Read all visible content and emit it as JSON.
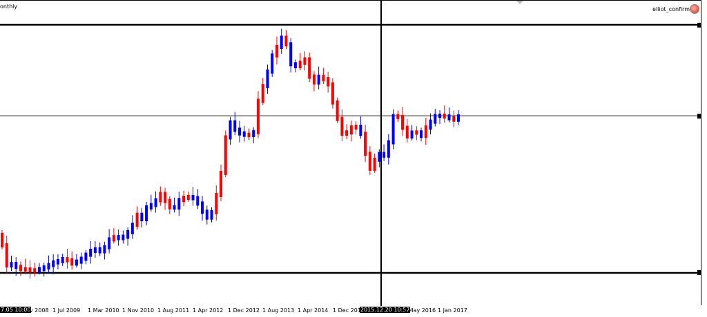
{
  "header": {
    "symbol_label": "onthly",
    "indicator_label": "elliot_confirm"
  },
  "colors": {
    "bull": "#0000ff",
    "bear": "#ff0000",
    "background": "#ffffff",
    "lines": "#000000"
  },
  "time_axis": {
    "labels": [
      "ov 2008",
      "1 Jul 2009",
      "1 Mar 2010",
      "1 Nov 2010",
      "1 Aug 2011",
      "1 Apr 2012",
      "1 Dec 2012",
      "1 Aug 2013",
      "1 Apr 2014",
      "1 Dec 2014",
      "1 May 2016",
      "1 Jan 2017"
    ],
    "start_label": "7.05 10:00",
    "crosshair_label": "2015.12.20 10:57"
  },
  "chart_data": {
    "type": "candlestick",
    "candle_direction": [
      "bear",
      "bear",
      "bull",
      "bull",
      "bear",
      "bear",
      "bear",
      "bear",
      "bull",
      "bull",
      "bull",
      "bull",
      "bull",
      "bull",
      "bear",
      "bear",
      "bull",
      "bull",
      "bull",
      "bull",
      "bull",
      "bull",
      "bull",
      "bull",
      "bear",
      "bull",
      "bull",
      "bull",
      "bull",
      "bear",
      "bull",
      "bull",
      "bull",
      "bull",
      "bear",
      "bear",
      "bear",
      "bull",
      "bull",
      "bear",
      "bear",
      "bull",
      "bull",
      "bull",
      "bull",
      "bull",
      "bear",
      "bear",
      "bear",
      "bull",
      "bull",
      "bull",
      "bull",
      "bear",
      "bull",
      "bear",
      "bear",
      "bull",
      "bull",
      "bear",
      "bull",
      "bear",
      "bull",
      "bull",
      "bear",
      "bear",
      "bear",
      "bear",
      "bull",
      "bear",
      "bear",
      "bear",
      "bear",
      "bear",
      "bear",
      "bear",
      "bear",
      "bull",
      "bear",
      "bear",
      "bear",
      "bull",
      "bull",
      "bull",
      "bull",
      "bear",
      "bear",
      "bear",
      "bull",
      "bear",
      "bull",
      "bear",
      "bull",
      "bull",
      "bull",
      "bear",
      "bull",
      "bear",
      "bull"
    ],
    "horizontal_lines": 3,
    "vertical_line": "2015.12.20 10:57"
  }
}
